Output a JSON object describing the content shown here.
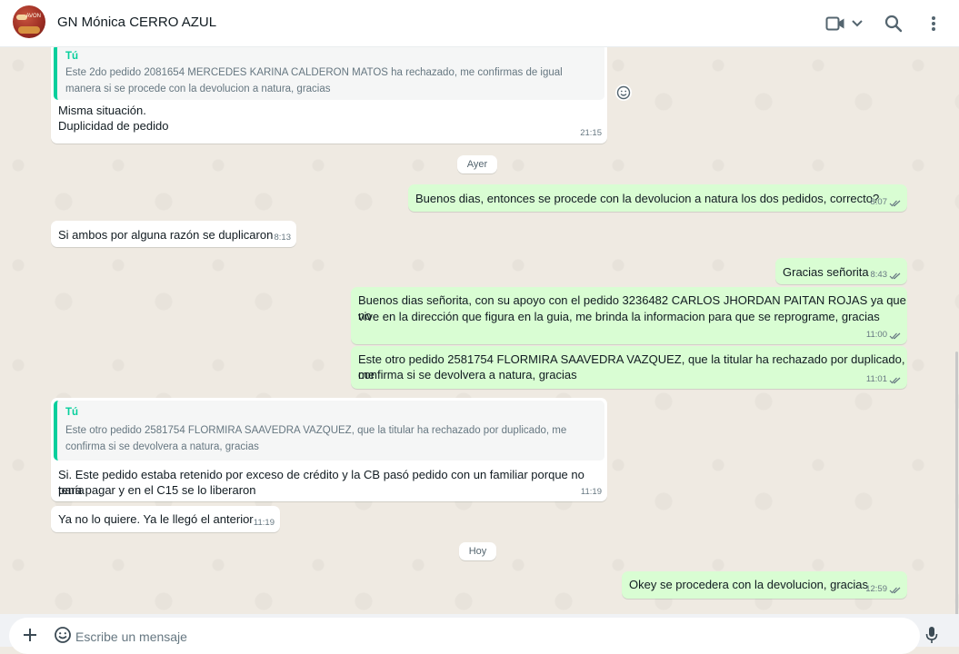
{
  "header": {
    "chat_title": "GN Mónica CERRO AZUL",
    "avatar_text": "AVON",
    "icons": [
      "video-call-icon",
      "chevron-down-icon",
      "search-icon",
      "menu-dots-icon"
    ]
  },
  "colors": {
    "incoming_bubble": "#ffffff",
    "outgoing_bubble": "#d9fdd3",
    "quote_accent": "#06cf9c",
    "chat_background": "#efeae2",
    "read_ticks": "#667781"
  },
  "messages": {
    "m1": {
      "quote_author": "Tú",
      "quote_text": "Este 2do pedido 2081654 MERCEDES KARINA CALDERON MATOS ha rechazado, me confirmas de igual manera si se procede con la devolucion a natura, gracias",
      "line1": "Misma situación.",
      "line2": "Duplicidad de pedido",
      "time": "21:15"
    },
    "date_yesterday": "Ayer",
    "m2": {
      "text": "Buenos dias, entonces se procede con la devolucion a natura los dos pedidos, correcto?",
      "time": "8:07"
    },
    "m3": {
      "text": "Si ambos por alguna razón se duplicaron",
      "time": "8:13"
    },
    "m4": {
      "text": "Gracias señorita",
      "time": "8:43"
    },
    "m5": {
      "line1": "Buenos dias señorita, con su apoyo con el pedido 3236482 CARLOS JHORDAN PAITAN ROJAS ya que no",
      "line2": "vive en la dirección que figura en la guia, me brinda la informacion para que se reprograme, gracias",
      "time": "11:00"
    },
    "m6": {
      "line1": "Este otro pedido 2581754 FLORMIRA SAAVEDRA VAZQUEZ, que la titular ha rechazado por duplicado, me",
      "line2": "confirma si se devolvera a natura, gracias",
      "time": "11:01"
    },
    "m7": {
      "quote_author": "Tú",
      "quote_text": "Este otro pedido 2581754 FLORMIRA SAAVEDRA VAZQUEZ, que la titular ha rechazado por duplicado, me confirma si se devolvera a natura, gracias",
      "line1": "Si. Este pedido estaba retenido por exceso de crédito y la CB pasó pedido con un familiar porque no tenía",
      "line2": "para pagar y en el C15 se lo liberaron",
      "time": "11:19"
    },
    "m8": {
      "text": "Ya no lo quiere. Ya le llegó el anterior",
      "time": "11:19"
    },
    "date_today": "Hoy",
    "m9": {
      "text": "Okey se procedera con la devolucion, gracias",
      "time": "12:59"
    }
  },
  "composer": {
    "placeholder": "Escribe un mensaje"
  }
}
